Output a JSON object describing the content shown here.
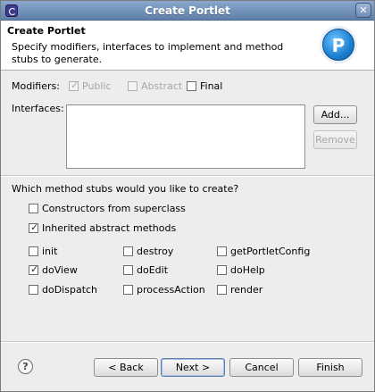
{
  "window": {
    "title": "Create Portlet"
  },
  "header": {
    "title": "Create Portlet",
    "description": "Specify modifiers, interfaces to implement and method stubs to generate."
  },
  "modifiers": {
    "label": "Modifiers:",
    "public": {
      "label": "Public",
      "checked": true,
      "disabled": true
    },
    "abstract": {
      "label": "Abstract",
      "checked": false,
      "disabled": true
    },
    "final": {
      "label": "Final",
      "checked": false,
      "disabled": false
    }
  },
  "interfaces": {
    "label": "Interfaces:",
    "items": [],
    "add_button": "Add...",
    "remove_button": "Remove"
  },
  "method_stubs": {
    "question": "Which method stubs would you like to create?",
    "constructors": {
      "label": "Constructors from superclass",
      "checked": false
    },
    "inherited": {
      "label": "Inherited abstract methods",
      "checked": true
    },
    "methods": [
      {
        "label": "init",
        "checked": false
      },
      {
        "label": "destroy",
        "checked": false
      },
      {
        "label": "getPortletConfig",
        "checked": false
      },
      {
        "label": "doView",
        "checked": true
      },
      {
        "label": "doEdit",
        "checked": false
      },
      {
        "label": "doHelp",
        "checked": false
      },
      {
        "label": "doDispatch",
        "checked": false
      },
      {
        "label": "processAction",
        "checked": false
      },
      {
        "label": "render",
        "checked": false
      }
    ]
  },
  "footer": {
    "help_icon": "?",
    "back_button": "< Back",
    "next_button": "Next >",
    "cancel_button": "Cancel",
    "finish_button": "Finish"
  },
  "icons": {
    "check": "✓",
    "close": "✕",
    "banner_letter": "P"
  }
}
